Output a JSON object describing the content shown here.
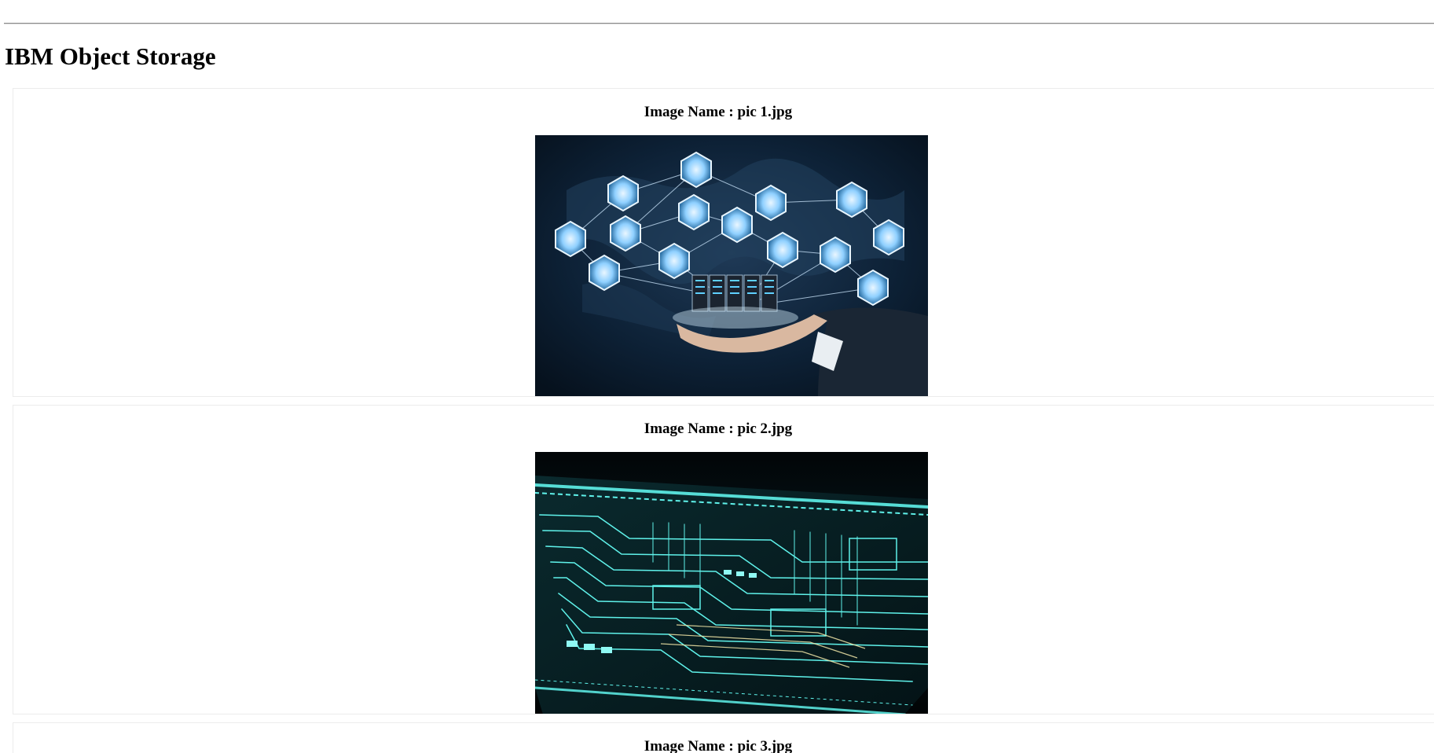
{
  "page": {
    "title": "IBM Object Storage"
  },
  "images": [
    {
      "caption": "Image Name : pic 1.jpg",
      "icon": "network-cloud-image"
    },
    {
      "caption": "Image Name : pic 2.jpg",
      "icon": "circuit-board-image"
    },
    {
      "caption": "Image Name : pic 3.jpg",
      "icon": "image"
    }
  ],
  "colors": {
    "page_background": "#ffffff",
    "rule": "#8a8a8a",
    "card_border": "#ececec",
    "photo1_background": "#0b1a2b",
    "photo2_background": "#020c10",
    "circuit_glow": "#4fe7e0"
  }
}
